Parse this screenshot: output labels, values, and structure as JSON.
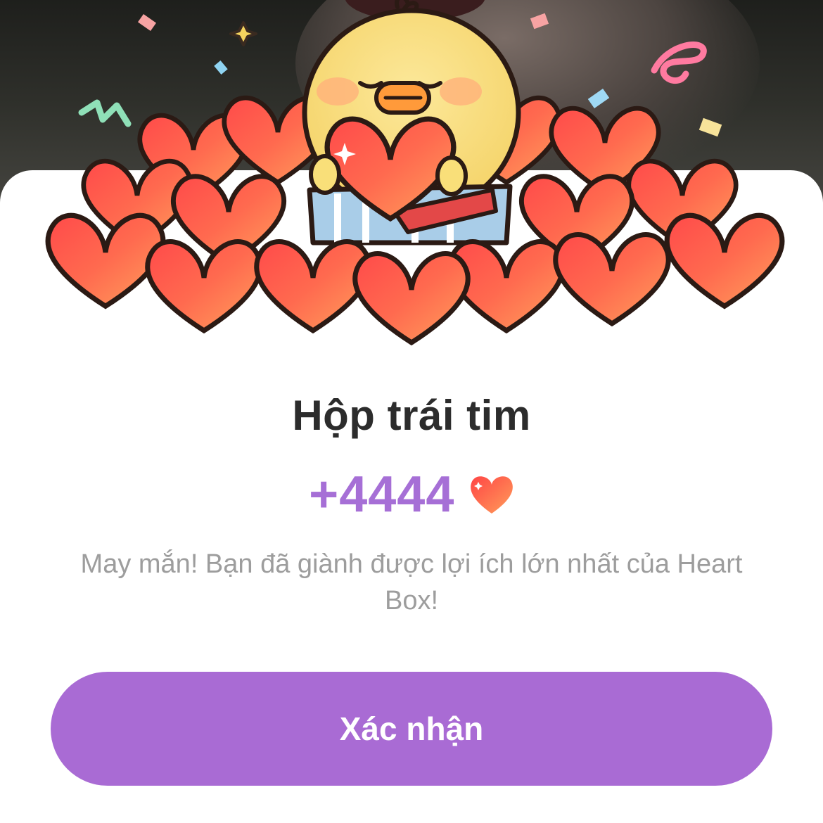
{
  "dialog": {
    "title": "Hộp trái tim",
    "reward_amount": "+4444",
    "reward_icon": "heart-icon",
    "message": "May mắn! Bạn đã giành được lợi ích lớn nhất của Heart Box!",
    "confirm_label": "Xác nhận"
  },
  "illustration": {
    "subject": "chick-holding-heart-with-gift-box-icon",
    "decoration": [
      "heart-icon",
      "confetti-icon",
      "sparkle-icon"
    ]
  },
  "colors": {
    "accent": "#a96bd4",
    "reward_text": "#a66fd6",
    "title_text": "#2c2c2c",
    "message_text": "#9d9d9d",
    "heart_light": "#ff9a5c",
    "heart_dark": "#ff4a4a",
    "chick": "#f9df79"
  }
}
